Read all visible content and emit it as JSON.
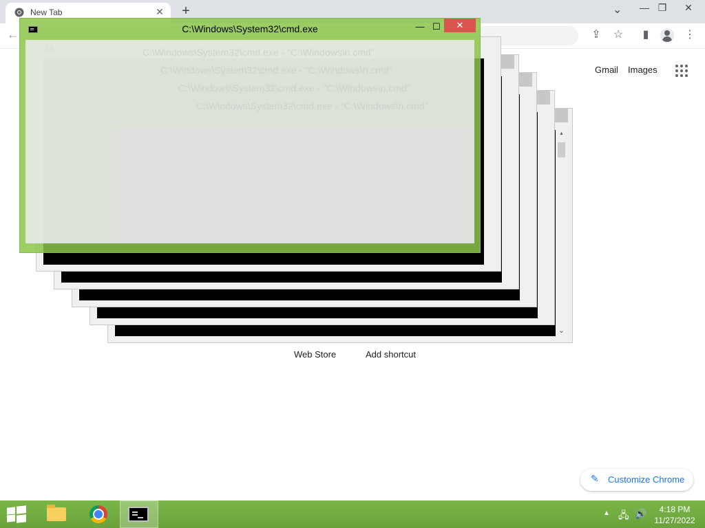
{
  "browser": {
    "tab": {
      "title": "New Tab"
    },
    "newtab_symbol": "+",
    "close_symbol": "✕",
    "tabsearch_symbol": "⌄",
    "window_controls": {
      "minimize": "—",
      "restore": "❐",
      "close": "✕"
    },
    "back_symbol": "←",
    "toolbar_icons": {
      "share": "⇪",
      "bookmark": "☆",
      "side_panel": "▮",
      "menu": "⋮"
    }
  },
  "ntp": {
    "header_links": {
      "gmail": "Gmail",
      "images": "Images"
    },
    "shortcuts": [
      "Web Store",
      "Add shortcut"
    ],
    "customize": {
      "label": "Customize Chrome",
      "icon_symbol": "✎"
    }
  },
  "cmd_windows": {
    "title": "C:\\Windows\\System32\\cmd.exe",
    "title_suffix": " - \"C:\\Windows\\n.cmd\"",
    "buttons": {
      "minimize": "—",
      "maximize": "☐",
      "close": "✕"
    },
    "scroll": {
      "up": "▲",
      "down": "⌄"
    }
  },
  "taskbar": {
    "tray": {
      "arrow": "▲",
      "network": "🖧",
      "volume": "🔊"
    },
    "clock": {
      "time": "4:18 PM",
      "date": "11/27/2022"
    }
  },
  "colors": {
    "taskbar": "#7ab648",
    "active_window_frame": "#8cc44a",
    "close_button_active": "#d9534f",
    "customize_accent": "#1a73e8"
  }
}
